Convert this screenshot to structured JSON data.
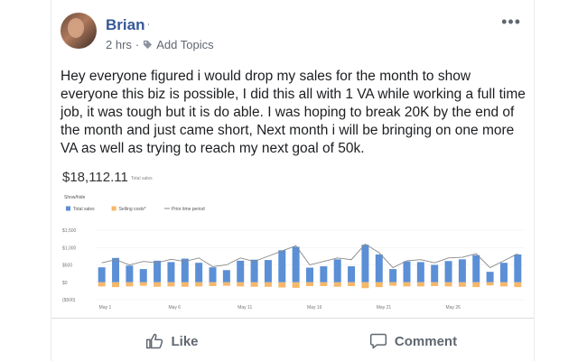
{
  "post": {
    "author": "Brian",
    "author_mark": "'",
    "time": "2 hrs",
    "separator": "·",
    "add_topics": "Add Topics",
    "more": "•••",
    "text": "Hey everyone figured i would drop my sales for the month to show everyone this biz is possible, I did this all with 1 VA while working a full time job, it was tough but it is do able. I was hoping to break 20K by the end of the month and just came short, Next month i will be bringing on one more VA as well as trying to reach my next goal of 50k."
  },
  "sales": {
    "total": "$18,112.11",
    "total_label": "Total sales",
    "show_hide": "Show/hide"
  },
  "chart_data": {
    "type": "bar",
    "legend": [
      {
        "name": "Total sales",
        "color": "#5b8fd6"
      },
      {
        "name": "Selling costs*",
        "color": "#f5b76a"
      },
      {
        "name": "Prior time period",
        "color": "#888888"
      }
    ],
    "y_ticks": [
      "$1,500",
      "$1,000",
      "$500",
      "$0",
      "($500)"
    ],
    "y_tick_values": [
      1500,
      1000,
      500,
      0,
      -500
    ],
    "ylim": [
      -500,
      1500
    ],
    "x_tick_labels": [
      "May 1",
      "May 6",
      "May 11",
      "May 16",
      "May 21",
      "May 26"
    ],
    "x_tick_days": [
      1,
      6,
      11,
      16,
      21,
      26
    ],
    "days": [
      1,
      2,
      3,
      4,
      5,
      6,
      7,
      8,
      9,
      10,
      11,
      12,
      13,
      14,
      15,
      16,
      17,
      18,
      19,
      20,
      21,
      22,
      23,
      24,
      25,
      26,
      27,
      28,
      29,
      30,
      31
    ],
    "series": [
      {
        "name": "Total sales",
        "values": [
          430,
          700,
          480,
          380,
          620,
          580,
          680,
          560,
          430,
          350,
          620,
          650,
          640,
          920,
          1020,
          420,
          460,
          660,
          460,
          1080,
          800,
          380,
          600,
          580,
          500,
          610,
          660,
          780,
          300,
          560,
          800
        ]
      },
      {
        "name": "Selling costs*",
        "values": [
          -120,
          -140,
          -120,
          -100,
          -130,
          -120,
          -130,
          -120,
          -110,
          -100,
          -120,
          -130,
          -130,
          -150,
          -160,
          -110,
          -110,
          -130,
          -110,
          -170,
          -140,
          -100,
          -120,
          -120,
          -110,
          -120,
          -130,
          -140,
          -90,
          -120,
          -140
        ]
      },
      {
        "name": "Prior time period",
        "values": [
          560,
          650,
          500,
          600,
          560,
          660,
          600,
          700,
          450,
          500,
          700,
          600,
          750,
          900,
          1050,
          500,
          600,
          700,
          650,
          1100,
          850,
          420,
          620,
          650,
          560,
          700,
          720,
          820,
          420,
          620,
          820
        ]
      }
    ]
  },
  "actions": {
    "like": "Like",
    "comment": "Comment"
  },
  "colors": {
    "link": "#365899",
    "meta": "#616770",
    "bar": "#5b8fd6",
    "cost": "#f5b76a",
    "line": "#888888"
  },
  "icons": [
    "more-options-icon",
    "tag-icon",
    "like-icon",
    "comment-icon"
  ]
}
